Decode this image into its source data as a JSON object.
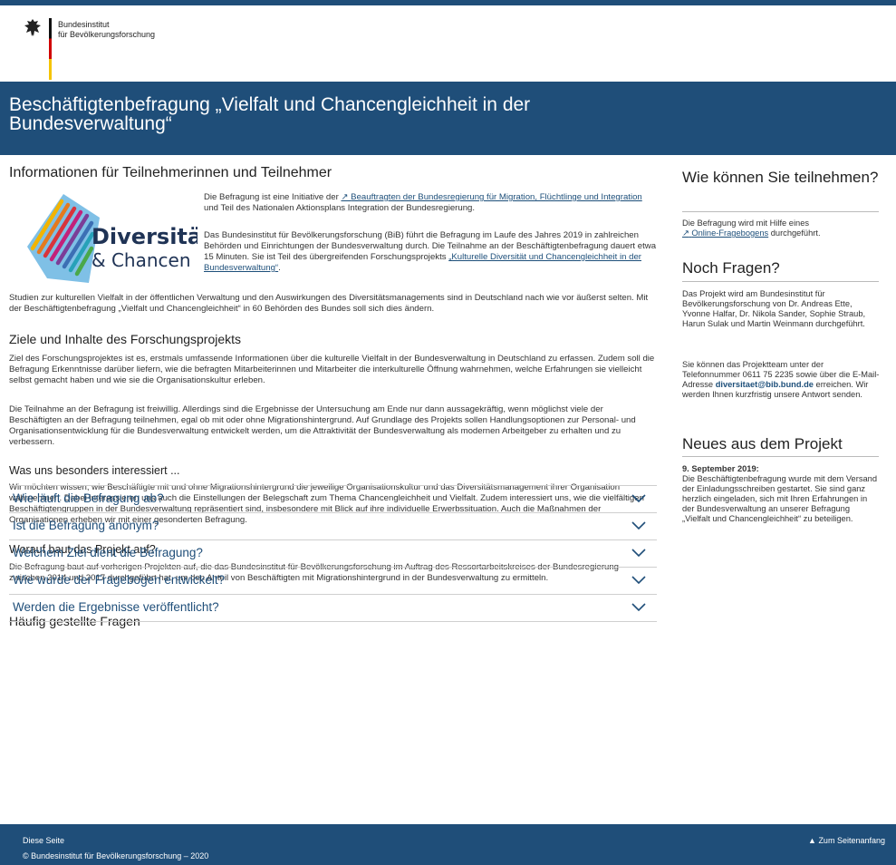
{
  "header": {
    "institute_line1": "Bundesinstitut",
    "institute_line2": "für Bevölkerungsforschung"
  },
  "banner": {
    "title": "Beschäftigtenbefragung „Vielfalt und Chancengleichheit in der Bundesverwaltung“"
  },
  "logo": {
    "word1": "Diversität",
    "word2": "& Chancen"
  },
  "main": {
    "heading": "Informationen für Teilnehmerinnen und Teilnehmer",
    "intro_p1_pre": "Die Befragung ist eine Initiative der ",
    "intro_p1_link": "Beauftragten der Bundesregierung für Migration, Flüchtlinge und Integration",
    "intro_p1_post": " und Teil des Nationalen Aktionsplans Integration der Bundesregierung.",
    "intro_p2_pre": "Das Bundesinstitut für Bevölkerungsforschung (BiB) führt die Befragung im Laufe des Jahres 2019 in zahlreichen Behörden und Einrichtungen der Bundesverwaltung durch. Die Teilnahme an der Beschäftigtenbefragung dauert etwa 15 Minuten. Sie ist Teil des übergreifenden Forschungsprojekts ",
    "intro_p2_link": "„Kulturelle Diversität und Chancengleichheit in der Bundesverwaltung“",
    "intro_p2_post": ".",
    "intro_p3": "Studien zur kulturellen Vielfalt in der öffentlichen Verwaltung und den Auswirkungen des Diversitätsmanagements sind in Deutschland nach wie vor äußerst selten. Mit der Beschäftigtenbefragung „Vielfalt und Chancengleichheit“ in 60 Behörden des Bundes soll sich dies ändern.",
    "goals_heading": "Ziele und Inhalte des Forschungsprojekts",
    "goals_p1": "Ziel des Forschungsprojektes ist es, erstmals umfassende Informationen über die kulturelle Vielfalt in der Bundesverwaltung in Deutschland zu erfassen. Zudem soll die Befragung Erkenntnisse darüber liefern, wie die befragten Mitarbeiterinnen und Mitarbeiter die interkulturelle Öffnung wahrnehmen, welche Erfahrungen sie vielleicht selbst gemacht haben und wie sie die Organisationskultur erleben.",
    "goals_p2": "Die Teilnahme an der Befragung ist freiwillig. Allerdings sind die Ergebnisse der Untersuchung am Ende nur dann aussagekräftig, wenn möglichst viele der Beschäftigten an der Befragung teilnehmen, egal ob mit oder ohne Migrationshintergrund. Auf Grundlage des Projekts sollen Handlungsoptionen zur Personal- und Organisationsentwicklung für die Bundesverwaltung entwickelt werden, um die Attraktivität der Bundesverwaltung als modernen Arbeitgeber zu erhalten und zu verbessern.",
    "interest_heading": "Was uns besonders interessiert ...",
    "interest_p": "Wir möchten wissen, wie Beschäftigte mit und ohne Migrationshintergrund die jeweilige Organisationskultur und das Diversitätsmanagement ihrer Organisation wahrnehmen. Dabei interessieren uns auch die Einstellungen der Belegschaft zum Thema Chancengleichheit und Vielfalt. Zudem interessiert uns, wie die vielfältigen Beschäftigtengruppen in der Bundesverwaltung repräsentiert sind, insbesondere mit Blick auf ihre individuelle Erwerbssituation. Auch die Maßnahmen der Organisationen erheben wir mit einer gesonderten Befragung.",
    "basis_heading": "Worauf baut das Projekt auf?",
    "basis_p": "Die Befragung baut auf vorherigen Projekten auf, die das Bundesinstitut für Bevölkerungsforschung im Auftrag des Ressortarbeitskreises der Bundesregierung zwischen 2014 und 2017 durchgeführt hat, um den Anteil von Beschäftigten mit Migrationshintergrund in der Bundesverwaltung zu ermitteln.",
    "faq_heading": "Häufig gestellte Fragen"
  },
  "faq": [
    {
      "question": "Wie läuft die Befragung ab?"
    },
    {
      "question": "Ist die Befragung anonym?"
    },
    {
      "question": "Welchem Ziel dient die Befragung?"
    },
    {
      "question": "Wie wurde der Fragebogen entwickelt?"
    },
    {
      "question": "Werden die Ergebnisse veröffentlicht?"
    }
  ],
  "sidebar": {
    "participate_heading": "Wie können Sie teilnehmen?",
    "participate_pre": "Die Befragung wird mit Hilfe eines",
    "participate_link": "Online-Fragebogens",
    "participate_post": " durchgeführt.",
    "questions_heading": "Noch Fragen?",
    "questions_p1": "Das Projekt wird am Bundesinstitut für Bevölkerungsforschung von Dr. Andreas Ette, Yvonne Halfar, Dr. Nikola Sander, Sophie Straub, Harun Sulak und Martin Weinmann durchgeführt.",
    "questions_p2_pre": "Sie können das Projektteam unter der Telefonnummer 0611 75 2235 sowie über die E-Mail-Adresse ",
    "email": "diversitaet@bib.bund.de",
    "questions_p2_post": " erreichen. Wir werden Ihnen kurzfristig unsere Antwort senden.",
    "news_heading": "Neues aus dem Projekt",
    "news_date": "9. September 2019:",
    "news_text": "Die Beschäftigtenbefragung wurde mit dem Versand der Einladungsschreiben gestartet. Sie sind ganz herzlich eingeladen, sich mit Ihren Erfahrungen in der Bundesverwaltung an unserer Befragung „Vielfalt und Chancengleichheit“ zu beteiligen."
  },
  "footer": {
    "this_page": "Diese Seite",
    "copyright": "© Bundesinstitut für Bevölkerungsforschung – 2020",
    "to_top": "▲ Zum Seitenanfang"
  },
  "colors": {
    "brand_blue": "#1f4e79",
    "link_blue": "#1d4f7a"
  },
  "icons": [
    "eagle-icon",
    "external-link-icon",
    "chevron-down-icon"
  ]
}
